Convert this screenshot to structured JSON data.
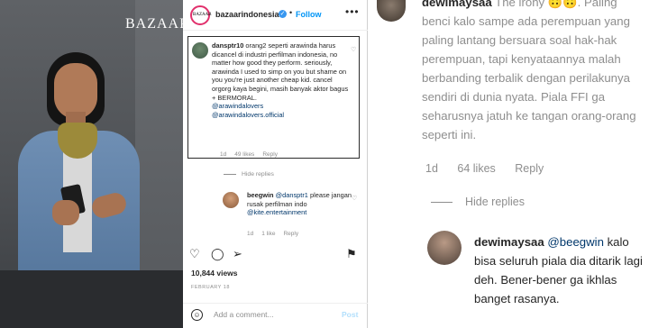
{
  "photo": {
    "brand": "BAZAAR"
  },
  "post_header": {
    "username": "bazaarindonesia",
    "separator": "•",
    "follow": "Follow",
    "avatar_text": "BAZAAR"
  },
  "comment1": {
    "username": "dansptr10",
    "text": "orang2 seperti arawinda harus dicancel di industri perfilman indonesia, no matter how good they perform. seriously, arawinda I used to simp on you but shame on you you're just another cheap kid. cancel orgorg kaya begini, masih banyak aktor bagus + BERMORAL.",
    "mention1": "@arawindalovers",
    "mention2": "@arawindalovers.official",
    "time": "1d",
    "likes": "49 likes",
    "reply": "Reply"
  },
  "hide_replies": "Hide replies",
  "comment2": {
    "username": "beegwin",
    "mention": "@dansptr1",
    "text": "please jangan rusak perfilman indo",
    "mention2": "@kite.entertainment",
    "time": "1d",
    "likes": "1 like",
    "reply": "Reply"
  },
  "actions": {
    "views": "10,844 views",
    "date": "FEBRUARY 18"
  },
  "add_comment": {
    "placeholder": "Add a comment...",
    "post": "Post"
  },
  "zoom": {
    "comment1": {
      "username": "dewimaysaa",
      "text_start": "The irony ",
      "emoji": "🙃🙃",
      "text_rest": ". Paling benci kalo sampe ada perempuan yang paling lantang bersuara soal hak-hak perempuan, tapi kenyataannya malah berbanding terbalik dengan perilakunya sendiri di dunia nyata. Piala FFI ga seharusnya jatuh ke tangan orang-orang seperti ini.",
      "time": "1d",
      "likes": "64 likes",
      "reply": "Reply"
    },
    "hide_replies": "Hide replies",
    "comment2": {
      "username": "dewimaysaa",
      "mention": "@beegwin",
      "text": "kalo bisa seluruh piala dia ditarik lagi deh. Bener-bener ga ikhlas banget rasanya."
    }
  }
}
